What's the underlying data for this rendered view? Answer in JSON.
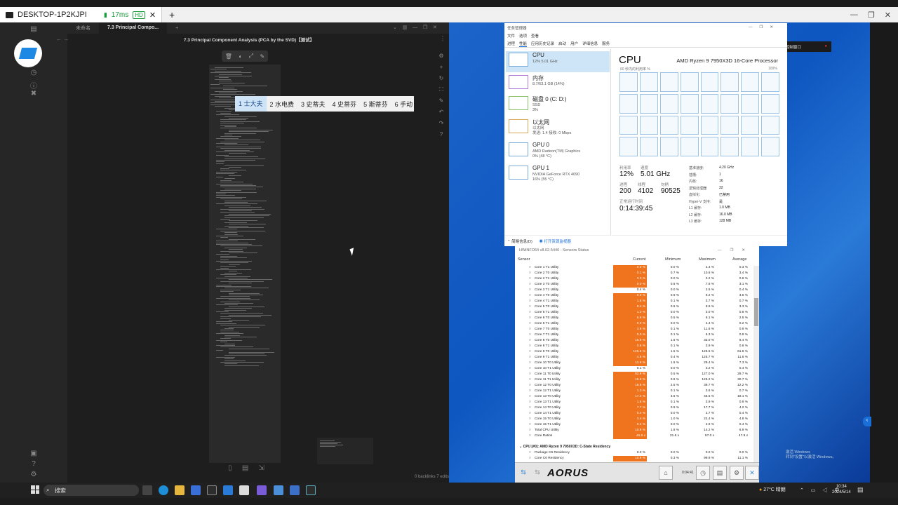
{
  "remote": {
    "device": "DESKTOP-1P2KJPI",
    "latency": "17ms",
    "quality": "HD",
    "new_tab": "+"
  },
  "obsidian": {
    "tabs": [
      "未命名",
      "7.3 Principal Compo..."
    ],
    "note_title": "7.3 Principal Component Analysis (PCA by the SVD)【测试】",
    "ime_candidates": [
      "1 士大夫",
      "2 水电费",
      "3 史蒂夫",
      "4 史蒂芬",
      "5 斯蒂芬",
      "6 手动"
    ],
    "status": "0 backlinks  7 edits"
  },
  "task_manager": {
    "title": "任务管理器",
    "menu": [
      "文件",
      "选项",
      "查看"
    ],
    "tabs": [
      "进程",
      "性能",
      "应用历史记录",
      "启动",
      "用户",
      "详细信息",
      "服务"
    ],
    "resources": [
      {
        "name": "CPU",
        "sub1": "12% 5.01 GHz",
        "sub2": ""
      },
      {
        "name": "内存",
        "sub1": "8.7/63.1 GB (14%)",
        "sub2": ""
      },
      {
        "name": "磁盘 0 (C: D:)",
        "sub1": "SSD",
        "sub2": "3%"
      },
      {
        "name": "以太网",
        "sub1": "以太网",
        "sub2": "发送: 1.4  接收: 0 Mbps"
      },
      {
        "name": "GPU 0",
        "sub1": "AMD Radeon(TM) Graphics",
        "sub2": "0% (48 °C)"
      },
      {
        "name": "GPU 1",
        "sub1": "NVIDIA GeForce RTX 4090",
        "sub2": "16% (55 °C)"
      }
    ],
    "cpu_header": "CPU",
    "cpu_name": "AMD Ryzen 9 7950X3D 16-Core Processor",
    "graph_label": "60 秒内的利用率 %",
    "graph_max": "100%",
    "stats": {
      "util_label": "利用率",
      "util": "12%",
      "speed_label": "速度",
      "speed": "5.01 GHz",
      "proc_label": "进程",
      "proc": "200",
      "thread_label": "线程",
      "thread": "4102",
      "handle_label": "句柄",
      "handle": "90525",
      "uptime_label": "正常运行时间",
      "uptime": "0:14:39:45"
    },
    "specs": [
      {
        "k": "基准速度:",
        "v": "4.20 GHz"
      },
      {
        "k": "插槽:",
        "v": "1"
      },
      {
        "k": "内核:",
        "v": "16"
      },
      {
        "k": "逻辑处理器:",
        "v": "32"
      },
      {
        "k": "虚拟化:",
        "v": "已禁用"
      },
      {
        "k": "Hyper-V 支持:",
        "v": "是"
      },
      {
        "k": "L1 缓存:",
        "v": "1.0 MB"
      },
      {
        "k": "L2 缓存:",
        "v": "16.0 MB"
      },
      {
        "k": "L3 缓存:",
        "v": "128 MB"
      }
    ],
    "footer_brief": "简略信息(D)",
    "footer_monitor": "打开资源监视器"
  },
  "hwinfo": {
    "title": "HWiNFO64 v8.02-5440 - Sensors Status",
    "columns": [
      "Sensor",
      "Current",
      "Minimum",
      "Maximum",
      "Average"
    ],
    "rows": [
      {
        "n": "Core 1 T1 Utility",
        "c": "0.0 %",
        "mi": "0.0 %",
        "ma": "2.4 %",
        "av": "0.3 %",
        "hot": true
      },
      {
        "n": "Core 2 T0 Utility",
        "c": "0.1 %",
        "mi": "0.7 %",
        "ma": "10.6 %",
        "av": "3.4 %",
        "hot": true
      },
      {
        "n": "Core 2 T1 Utility",
        "c": "3.3 %",
        "mi": "0.0 %",
        "ma": "3.2 %",
        "av": "0.6 %",
        "hot": true
      },
      {
        "n": "Core 3 T0 Utility",
        "c": "0.0 %",
        "mi": "0.6 %",
        "ma": "7.8 %",
        "av": "3.1 %",
        "hot": true
      },
      {
        "n": "Core 3 T1 Utility",
        "c": "0.4 %",
        "mi": "0.0 %",
        "ma": "2.5 %",
        "av": "0.4 %",
        "hot": false
      },
      {
        "n": "Core 4 T0 Utility",
        "c": "0.0 %",
        "mi": "0.9 %",
        "ma": "9.2 %",
        "av": "3.6 %",
        "hot": true
      },
      {
        "n": "Core 4 T1 Utility",
        "c": "1.8 %",
        "mi": "0.1 %",
        "ma": "3.7 %",
        "av": "0.7 %",
        "hot": true
      },
      {
        "n": "Core 5 T0 Utility",
        "c": "8.4 %",
        "mi": "0.6 %",
        "ma": "8.9 %",
        "av": "3.3 %",
        "hot": true
      },
      {
        "n": "Core 5 T1 Utility",
        "c": "1.3 %",
        "mi": "0.0 %",
        "ma": "3.0 %",
        "av": "0.6 %",
        "hot": true
      },
      {
        "n": "Core 6 T0 Utility",
        "c": "6.9 %",
        "mi": "0.5 %",
        "ma": "6.1 %",
        "av": "2.5 %",
        "hot": true
      },
      {
        "n": "Core 6 T1 Utility",
        "c": "0.0 %",
        "mi": "0.0 %",
        "ma": "2.4 %",
        "av": "0.2 %",
        "hot": true
      },
      {
        "n": "Core 7 T0 Utility",
        "c": "3.9 %",
        "mi": "0.1 %",
        "ma": "11.6 %",
        "av": "0.9 %",
        "hot": true
      },
      {
        "n": "Core 7 T1 Utility",
        "c": "0.0 %",
        "mi": "0.1 %",
        "ma": "6.3 %",
        "av": "0.9 %",
        "hot": true
      },
      {
        "n": "Core 8 T0 Utility",
        "c": "16.9 %",
        "mi": "1.6 %",
        "ma": "33.0 %",
        "av": "8.4 %",
        "hot": true
      },
      {
        "n": "Core 8 T1 Utility",
        "c": "0.6 %",
        "mi": "0.1 %",
        "ma": "3.9 %",
        "av": "0.6 %",
        "hot": true
      },
      {
        "n": "Core 9 T0 Utility",
        "c": "126.5 %",
        "mi": "1.5 %",
        "ma": "126.5 %",
        "av": "61.6 %",
        "hot": true
      },
      {
        "n": "Core 9 T1 Utility",
        "c": "4.6 %",
        "mi": "0.4 %",
        "ma": "125.7 %",
        "av": "11.6 %",
        "hot": true
      },
      {
        "n": "Core 10 T0 Utility",
        "c": "12.9 %",
        "mi": "1.6 %",
        "ma": "29.4 %",
        "av": "7.3 %",
        "hot": true
      },
      {
        "n": "Core 10 T1 Utility",
        "c": "0.1 %",
        "mi": "0.0 %",
        "ma": "3.2 %",
        "av": "0.4 %",
        "hot": false
      },
      {
        "n": "Core 11 T0 Utility",
        "c": "62.9 %",
        "mi": "0.5 %",
        "ma": "127.0 %",
        "av": "29.7 %",
        "hot": true
      },
      {
        "n": "Core 11 T1 Utility",
        "c": "15.9 %",
        "mi": "0.8 %",
        "ma": "125.2 %",
        "av": "30.7 %",
        "hot": true
      },
      {
        "n": "Core 12 T0 Utility",
        "c": "18.6 %",
        "mi": "2.5 %",
        "ma": "39.7 %",
        "av": "12.2 %",
        "hot": true
      },
      {
        "n": "Core 12 T1 Utility",
        "c": "1.3 %",
        "mi": "0.1 %",
        "ma": "3.6 %",
        "av": "0.7 %",
        "hot": true
      },
      {
        "n": "Core 13 T0 Utility",
        "c": "17.4 %",
        "mi": "3.6 %",
        "ma": "45.5 %",
        "av": "18.1 %",
        "hot": true
      },
      {
        "n": "Core 13 T1 Utility",
        "c": "1.8 %",
        "mi": "0.1 %",
        "ma": "3.9 %",
        "av": "0.9 %",
        "hot": true
      },
      {
        "n": "Core 14 T0 Utility",
        "c": "7.7 %",
        "mi": "0.9 %",
        "ma": "17.7 %",
        "av": "4.2 %",
        "hot": true
      },
      {
        "n": "Core 14 T1 Utility",
        "c": "0.4 %",
        "mi": "0.0 %",
        "ma": "2.7 %",
        "av": "0.4 %",
        "hot": true
      },
      {
        "n": "Core 15 T0 Utility",
        "c": "3.4 %",
        "mi": "1.0 %",
        "ma": "22.4 %",
        "av": "4.8 %",
        "hot": true
      },
      {
        "n": "Core 15 T1 Utility",
        "c": "0.2 %",
        "mi": "0.0 %",
        "ma": "2.9 %",
        "av": "0.4 %",
        "hot": true
      },
      {
        "n": "Total CPU Utility",
        "c": "10.9 %",
        "mi": "1.8 %",
        "ma": "14.2 %",
        "av": "6.9 %",
        "hot": true
      },
      {
        "n": "Core Ratios",
        "c": "46.8 x",
        "mi": "31.6 x",
        "ma": "57.0 x",
        "av": "47.9 x",
        "hot": true
      }
    ],
    "section": "CPU [#0]: AMD Ryzen 9 7950X3D: C-State Residency",
    "rows2": [
      {
        "n": "Package C6 Residency",
        "c": "0.0 %",
        "mi": "0.0 %",
        "ma": "0.0 %",
        "av": "0.0 %",
        "hot": false
      },
      {
        "n": "Core C0 Residency",
        "c": "10.9 %",
        "mi": "0.3 %",
        "ma": "99.9 %",
        "av": "11.1 %",
        "hot": true
      }
    ],
    "brand": "AORUS",
    "timer": "0:04:41"
  },
  "notification": "远程控制窗口",
  "watermark": [
    "激活 Windows",
    "转到\"设置\"以激活 Windows。"
  ],
  "taskbar": {
    "search": "搜索",
    "weather": "27°C  晴朗",
    "time": "10:34",
    "date": "2024/5/14"
  },
  "colors": {
    "accent": "#1a6ed8",
    "hot": "#f0731e"
  }
}
